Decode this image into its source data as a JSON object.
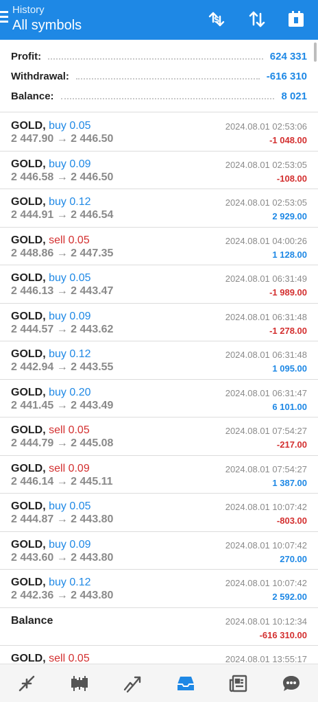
{
  "header": {
    "subtitle": "History",
    "title": "All symbols"
  },
  "summary": {
    "profit_label": "Profit:",
    "profit_value": "624 331",
    "withdrawal_label": "Withdrawal:",
    "withdrawal_value": "-616 310",
    "balance_label": "Balance:",
    "balance_value": "8 021"
  },
  "deals": [
    {
      "symbol": "GOLD,",
      "type": "buy 0.05",
      "side": "buy",
      "prices": "2 447.90 → 2 446.50",
      "time": "2024.08.01 02:53:06",
      "profit": "-1 048.00",
      "sign": "neg"
    },
    {
      "symbol": "GOLD,",
      "type": "buy 0.09",
      "side": "buy",
      "prices": "2 446.58 → 2 446.50",
      "time": "2024.08.01 02:53:05",
      "profit": "-108.00",
      "sign": "neg"
    },
    {
      "symbol": "GOLD,",
      "type": "buy 0.12",
      "side": "buy",
      "prices": "2 444.91 → 2 446.54",
      "time": "2024.08.01 02:53:05",
      "profit": "2 929.00",
      "sign": "pos"
    },
    {
      "symbol": "GOLD,",
      "type": "sell 0.05",
      "side": "sell",
      "prices": "2 448.86 → 2 447.35",
      "time": "2024.08.01 04:00:26",
      "profit": "1 128.00",
      "sign": "pos"
    },
    {
      "symbol": "GOLD,",
      "type": "buy 0.05",
      "side": "buy",
      "prices": "2 446.13 → 2 443.47",
      "time": "2024.08.01 06:31:49",
      "profit": "-1 989.00",
      "sign": "neg"
    },
    {
      "symbol": "GOLD,",
      "type": "buy 0.09",
      "side": "buy",
      "prices": "2 444.57 → 2 443.62",
      "time": "2024.08.01 06:31:48",
      "profit": "-1 278.00",
      "sign": "neg"
    },
    {
      "symbol": "GOLD,",
      "type": "buy 0.12",
      "side": "buy",
      "prices": "2 442.94 → 2 443.55",
      "time": "2024.08.01 06:31:48",
      "profit": "1 095.00",
      "sign": "pos"
    },
    {
      "symbol": "GOLD,",
      "type": "buy 0.20",
      "side": "buy",
      "prices": "2 441.45 → 2 443.49",
      "time": "2024.08.01 06:31:47",
      "profit": "6 101.00",
      "sign": "pos"
    },
    {
      "symbol": "GOLD,",
      "type": "sell 0.05",
      "side": "sell",
      "prices": "2 444.79 → 2 445.08",
      "time": "2024.08.01 07:54:27",
      "profit": "-217.00",
      "sign": "neg"
    },
    {
      "symbol": "GOLD,",
      "type": "sell 0.09",
      "side": "sell",
      "prices": "2 446.14 → 2 445.11",
      "time": "2024.08.01 07:54:27",
      "profit": "1 387.00",
      "sign": "pos"
    },
    {
      "symbol": "GOLD,",
      "type": "buy 0.05",
      "side": "buy",
      "prices": "2 444.87 → 2 443.80",
      "time": "2024.08.01 10:07:42",
      "profit": "-803.00",
      "sign": "neg"
    },
    {
      "symbol": "GOLD,",
      "type": "buy 0.09",
      "side": "buy",
      "prices": "2 443.60 → 2 443.80",
      "time": "2024.08.01 10:07:42",
      "profit": "270.00",
      "sign": "pos"
    },
    {
      "symbol": "GOLD,",
      "type": "buy 0.12",
      "side": "buy",
      "prices": "2 442.36 → 2 443.80",
      "time": "2024.08.01 10:07:42",
      "profit": "2 592.00",
      "sign": "pos"
    },
    {
      "symbol": "Balance",
      "type": "",
      "side": "buy",
      "prices": "",
      "time": "2024.08.01 10:12:34",
      "profit": "-616 310.00",
      "sign": "neg"
    },
    {
      "symbol": "GOLD,",
      "type": "sell 0.05",
      "side": "sell",
      "prices": "",
      "time": "2024.08.01 13:55:17",
      "profit": "",
      "sign": "pos"
    }
  ],
  "icons": {
    "header": [
      "menu-icon",
      "currency-exchange-icon",
      "sort-icon",
      "calendar-icon"
    ],
    "nav": [
      "quotes-icon",
      "chart-icon",
      "trade-icon",
      "history-icon",
      "news-icon",
      "chat-icon"
    ]
  },
  "colors": {
    "accent": "#1e88e5",
    "negative": "#d32f2f",
    "muted": "#8a8a8a"
  }
}
